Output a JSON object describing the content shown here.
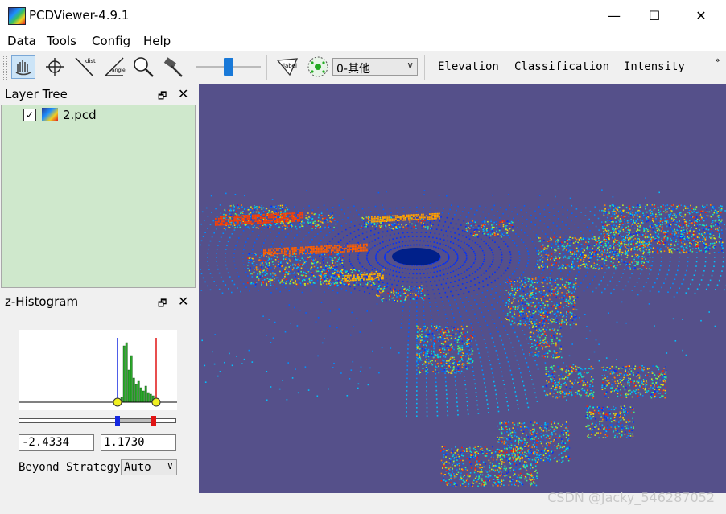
{
  "window": {
    "title": "PCDViewer-4.9.1",
    "minimize": "—",
    "maximize": "☐",
    "close": "✕"
  },
  "menu": [
    "Data",
    "Tools",
    "Config",
    "Help"
  ],
  "toolbar": {
    "label_tool_text": "label",
    "dist_tool_text": "dist",
    "angle_tool_text": "angle",
    "class_select_value": "0-其他",
    "color_modes": [
      "Elevation",
      "Classification",
      "Intensity"
    ],
    "overflow": "»"
  },
  "layer_tree": {
    "title": "Layer Tree",
    "float": "🗗",
    "close": "✕",
    "items": [
      {
        "name": "2.pcd",
        "checked": "✓"
      }
    ]
  },
  "histogram": {
    "title": "z-Histogram",
    "float": "🗗",
    "close": "✕",
    "min_value": "-2.4334",
    "max_value": "1.1730",
    "beyond_label": "Beyond Strategy",
    "beyond_value": "Auto"
  },
  "watermark": "CSDN @Jacky_546287052",
  "colors": {
    "viewport_bg": "#55508a",
    "layer_bg": "#cfe8cc",
    "accent": "#1979d8"
  },
  "icons": [
    "app-icon",
    "select-icon",
    "crosshair-icon",
    "dist-icon",
    "angle-icon",
    "zoom-icon",
    "hammer-icon",
    "label-icon",
    "cluster-icon",
    "chevron-down-icon"
  ]
}
